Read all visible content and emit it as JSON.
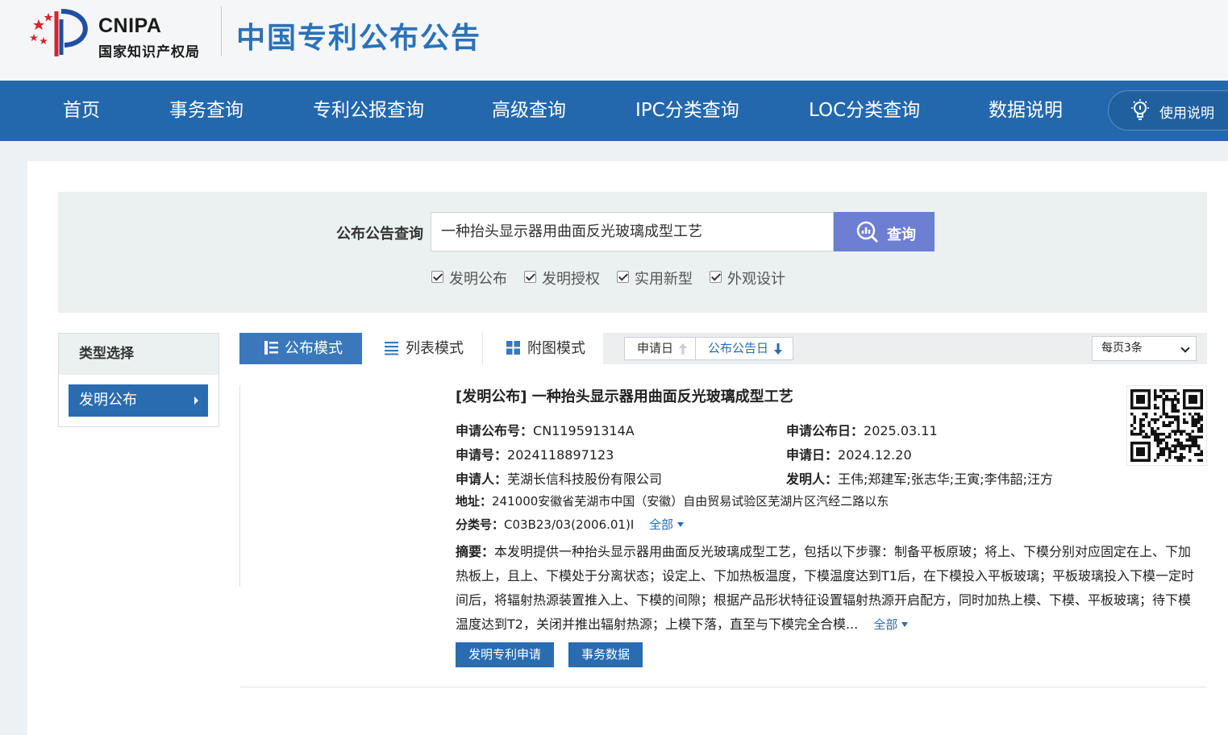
{
  "header": {
    "logo_en": "CNIPA",
    "logo_cn": "国家知识产权局",
    "site_title": "中国专利公布公告"
  },
  "nav": {
    "items": [
      "首页",
      "事务查询",
      "专利公报查询",
      "高级查询",
      "IPC分类查询",
      "LOC分类查询",
      "数据说明"
    ],
    "help_label": "使用说明"
  },
  "search": {
    "label": "公布公告查询",
    "value": "一种抬头显示器用曲面反光玻璃成型工艺",
    "button": "查询",
    "checkboxes": [
      {
        "label": "发明公布",
        "checked": true
      },
      {
        "label": "发明授权",
        "checked": true
      },
      {
        "label": "实用新型",
        "checked": true
      },
      {
        "label": "外观设计",
        "checked": true
      }
    ]
  },
  "sidebar": {
    "title": "类型选择",
    "items": [
      {
        "label": "发明公布"
      }
    ]
  },
  "toolbar": {
    "modes": [
      "公布模式",
      "列表模式",
      "附图模式"
    ],
    "sort_apply_date": "申请日",
    "sort_pub_date": "公布公告日",
    "per_page": "每页3条"
  },
  "result": {
    "title": "[发明公布] 一种抬头显示器用曲面反光玻璃成型工艺",
    "pub_no_label": "申请公布号：",
    "pub_no": "CN119591314A",
    "pub_date_label": "申请公布日：",
    "pub_date": "2025.03.11",
    "app_no_label": "申请号：",
    "app_no": "2024118897123",
    "app_date_label": "申请日：",
    "app_date": "2024.12.20",
    "applicant_label": "申请人：",
    "applicant": "芜湖长信科技股份有限公司",
    "inventor_label": "发明人：",
    "inventor": "王伟;郑建军;张志华;王寅;李伟韶;汪方",
    "address_label": "地址：",
    "address": "241000安徽省芜湖市中国（安徽）自由贸易试验区芜湖片区汽经二路以东",
    "class_label": "分类号：",
    "class_no": "C03B23/03(2006.01)I",
    "more_label": "全部",
    "abstract_label": "摘要：",
    "abstract_lines": [
      "本发明提供一种抬头显示器用曲面反光玻璃成型工艺，包括以下步骤：制备平板原玻；将上、下模分别对应固定在上、下加",
      "热板上，且上、下模处于分离状态；设定上、下加热板温度，下模温度达到T1后，在下模投入平板玻璃；平板玻璃投入下模一定时",
      "间后，将辐射热源装置推入上、下模的间隙；根据产品形状特征设置辐射热源开启配方，同时加热上模、下模、平板玻璃；待下模",
      "温度达到T2，关闭并推出辐射热源；上模下落，直至与下模完全合模..."
    ],
    "buttons": [
      "发明专利申请",
      "事务数据"
    ]
  }
}
